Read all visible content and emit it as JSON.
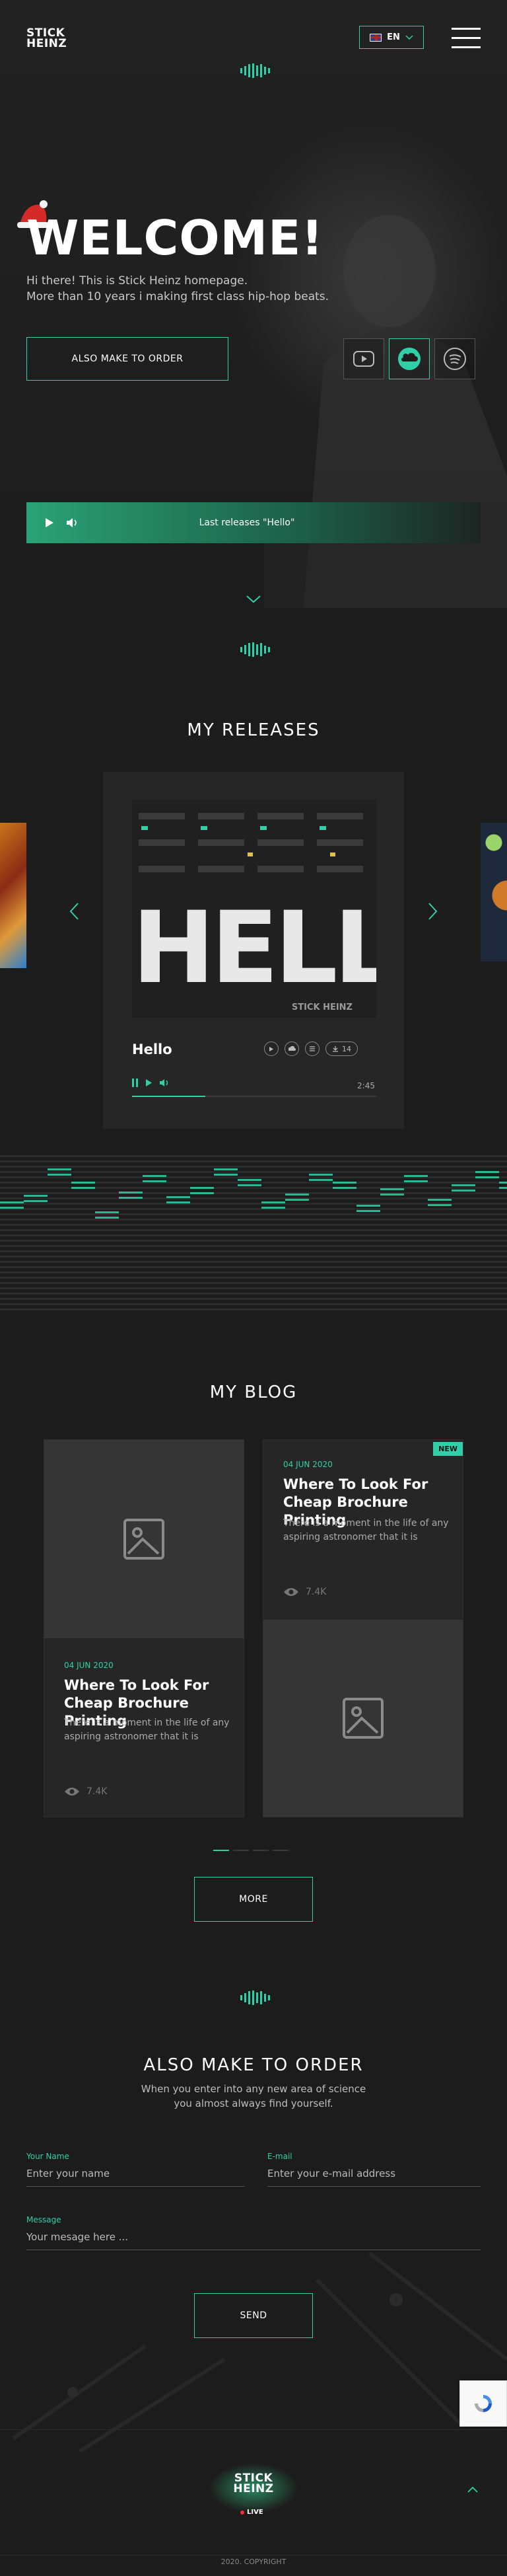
{
  "header": {
    "logo_line1": "STICK",
    "logo_line2": "HEINZ",
    "lang": "EN"
  },
  "hero": {
    "title": "WELCOME!",
    "subtitle_line1": "Hi there! This is Stick Heinz homepage.",
    "subtitle_line2": "More than 10 years i making first class hip-hop beats.",
    "order_button": "ALSO MAKE TO ORDER",
    "socials": [
      "youtube-icon",
      "soundcloud-icon",
      "spotify-icon"
    ],
    "player_label": "Last releases \"Hello\""
  },
  "releases": {
    "title": "MY RELEASES",
    "card": {
      "cover_text": "HELLO",
      "cover_brand": "STICK HEINZ",
      "track_name": "Hello",
      "downloads": "14",
      "time": "2:45",
      "progress": 0.3
    }
  },
  "blog": {
    "title": "MY BLOG",
    "posts": [
      {
        "date": "04 JUN 2020",
        "title": "Where To Look For Cheap Brochure Printing",
        "text": "There is a moment in the life of any aspiring astronomer that it is",
        "views": "7.4K"
      },
      {
        "badge": "NEW",
        "date": "04 JUN 2020",
        "title": "Where To Look For Cheap Brochure Printing",
        "text": "There is a moment in the life of any aspiring astronomer that it is",
        "views": "7.4K"
      }
    ],
    "more_button": "MORE"
  },
  "order": {
    "title": "ALSO MAKE TO ORDER",
    "subtitle_line1": "When you enter into any new area of science",
    "subtitle_line2": "you almost always find yourself.",
    "name_label": "Your Name",
    "name_placeholder": "Enter your name",
    "email_label": "E-mail",
    "email_placeholder": "Enter your e-mail address",
    "message_label": "Message",
    "message_placeholder": "Your mesage here ...",
    "send_button": "SEND"
  },
  "footer": {
    "logo_line1": "STICK",
    "logo_line2": "HEINZ",
    "live": "LIVE",
    "copyright": "2020. COPYRIGHT"
  },
  "colors": {
    "accent": "#2fd0a8",
    "background": "#1c1c1c"
  }
}
